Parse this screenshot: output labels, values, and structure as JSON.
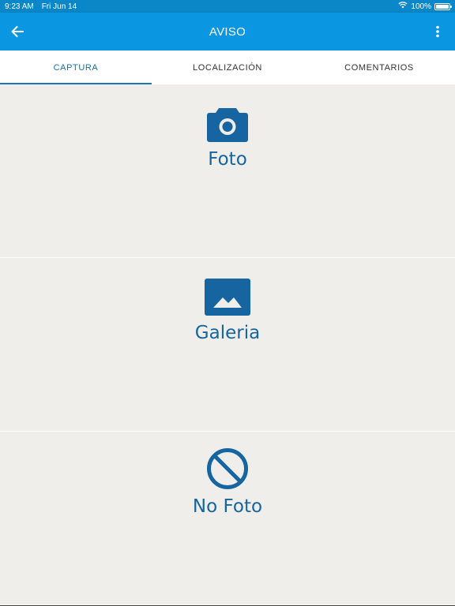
{
  "status_bar": {
    "time": "9:23 AM",
    "date": "Fri Jun 14",
    "battery": "100%",
    "battery_level": 1.0,
    "icons": [
      "wifi-icon",
      "battery-icon"
    ]
  },
  "app_bar": {
    "title": "AVISO",
    "back_icon": "arrow-left-icon",
    "menu_icon": "more-vert-icon",
    "color": "#0a96e0"
  },
  "tabs": [
    {
      "label": "CAPTURA",
      "active": true
    },
    {
      "label": "LOCALIZACIÓN",
      "active": false
    },
    {
      "label": "COMENTARIOS",
      "active": false
    }
  ],
  "options": [
    {
      "label": "Foto",
      "icon": "camera-icon"
    },
    {
      "label": "Galeria",
      "icon": "image-icon"
    },
    {
      "label": "No Foto",
      "icon": "block-icon"
    }
  ],
  "colors": {
    "accent": "#1665a0",
    "background": "#efeeea"
  }
}
